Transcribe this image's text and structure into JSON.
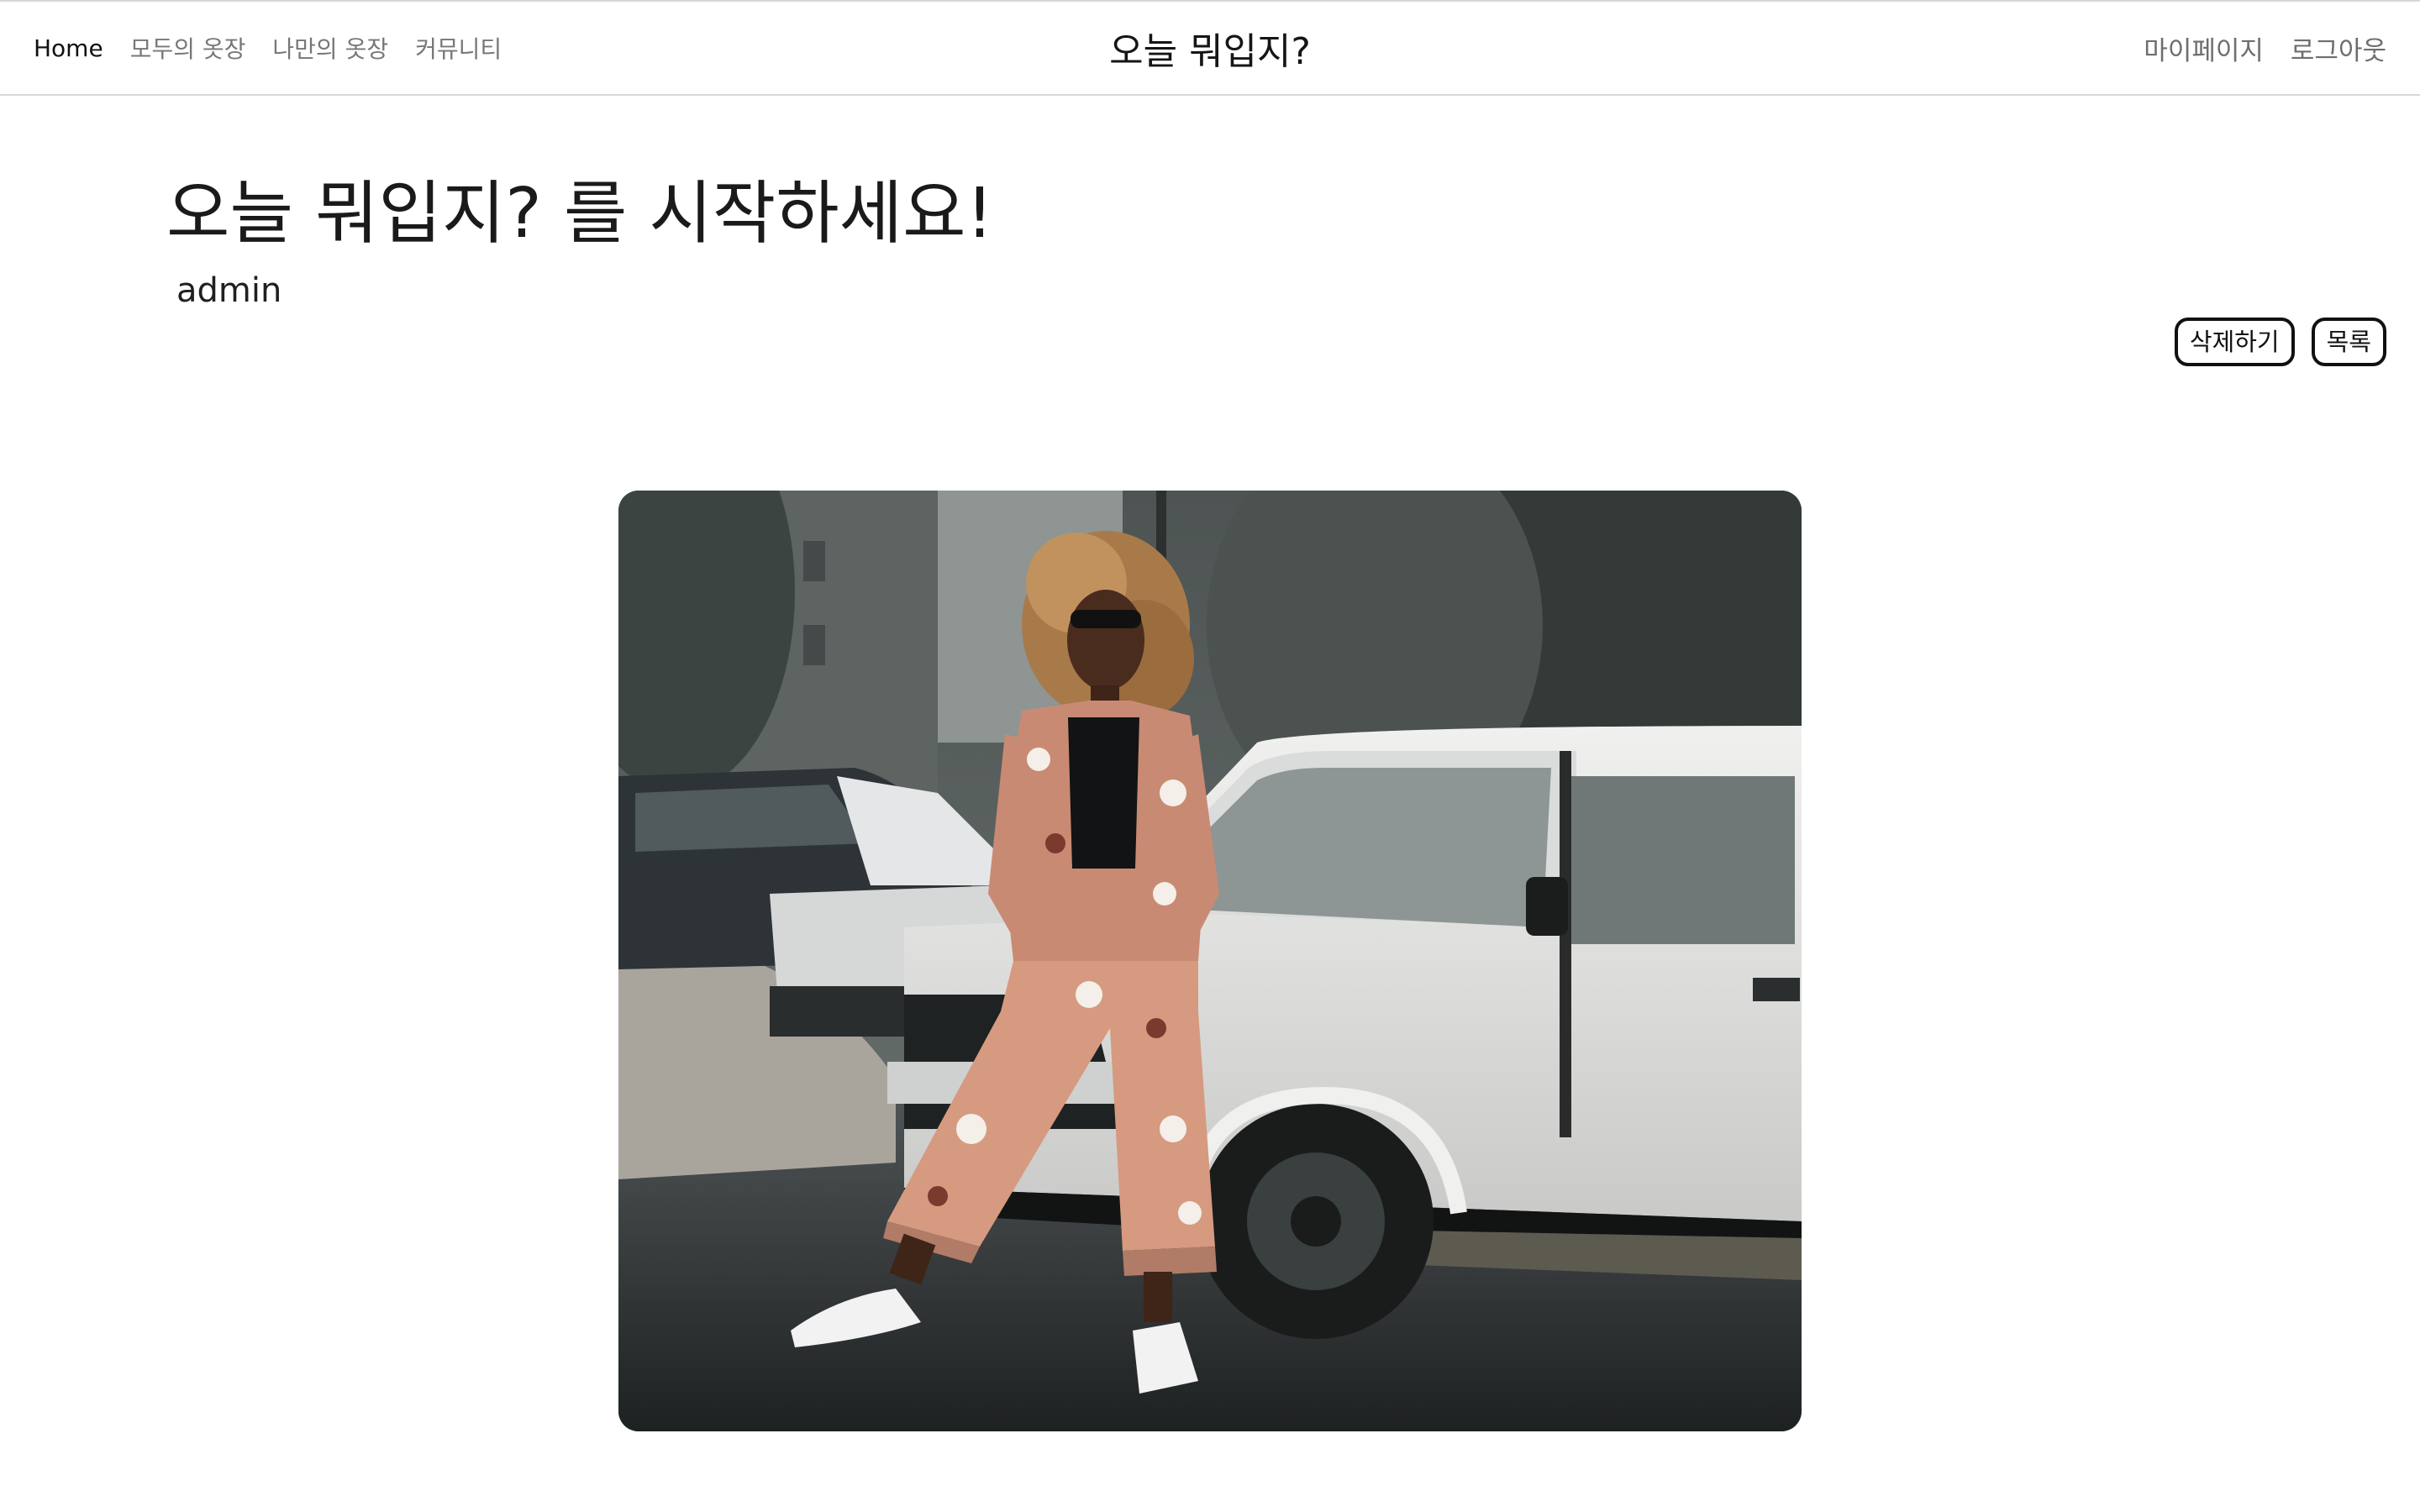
{
  "nav": {
    "left_links": [
      "Home",
      "모두의 옷장",
      "나만의 옷장",
      "커뮤니티"
    ],
    "brand": "오늘 뭐입지?",
    "right_links": [
      "마이페이지",
      "로그아웃"
    ]
  },
  "post": {
    "title": "오늘 뭐입지? 를 시작하세요!",
    "author": "admin",
    "actions": {
      "delete_label": "삭제하기",
      "list_label": "목록"
    }
  },
  "photo": {
    "icon": "outfit-photo"
  }
}
